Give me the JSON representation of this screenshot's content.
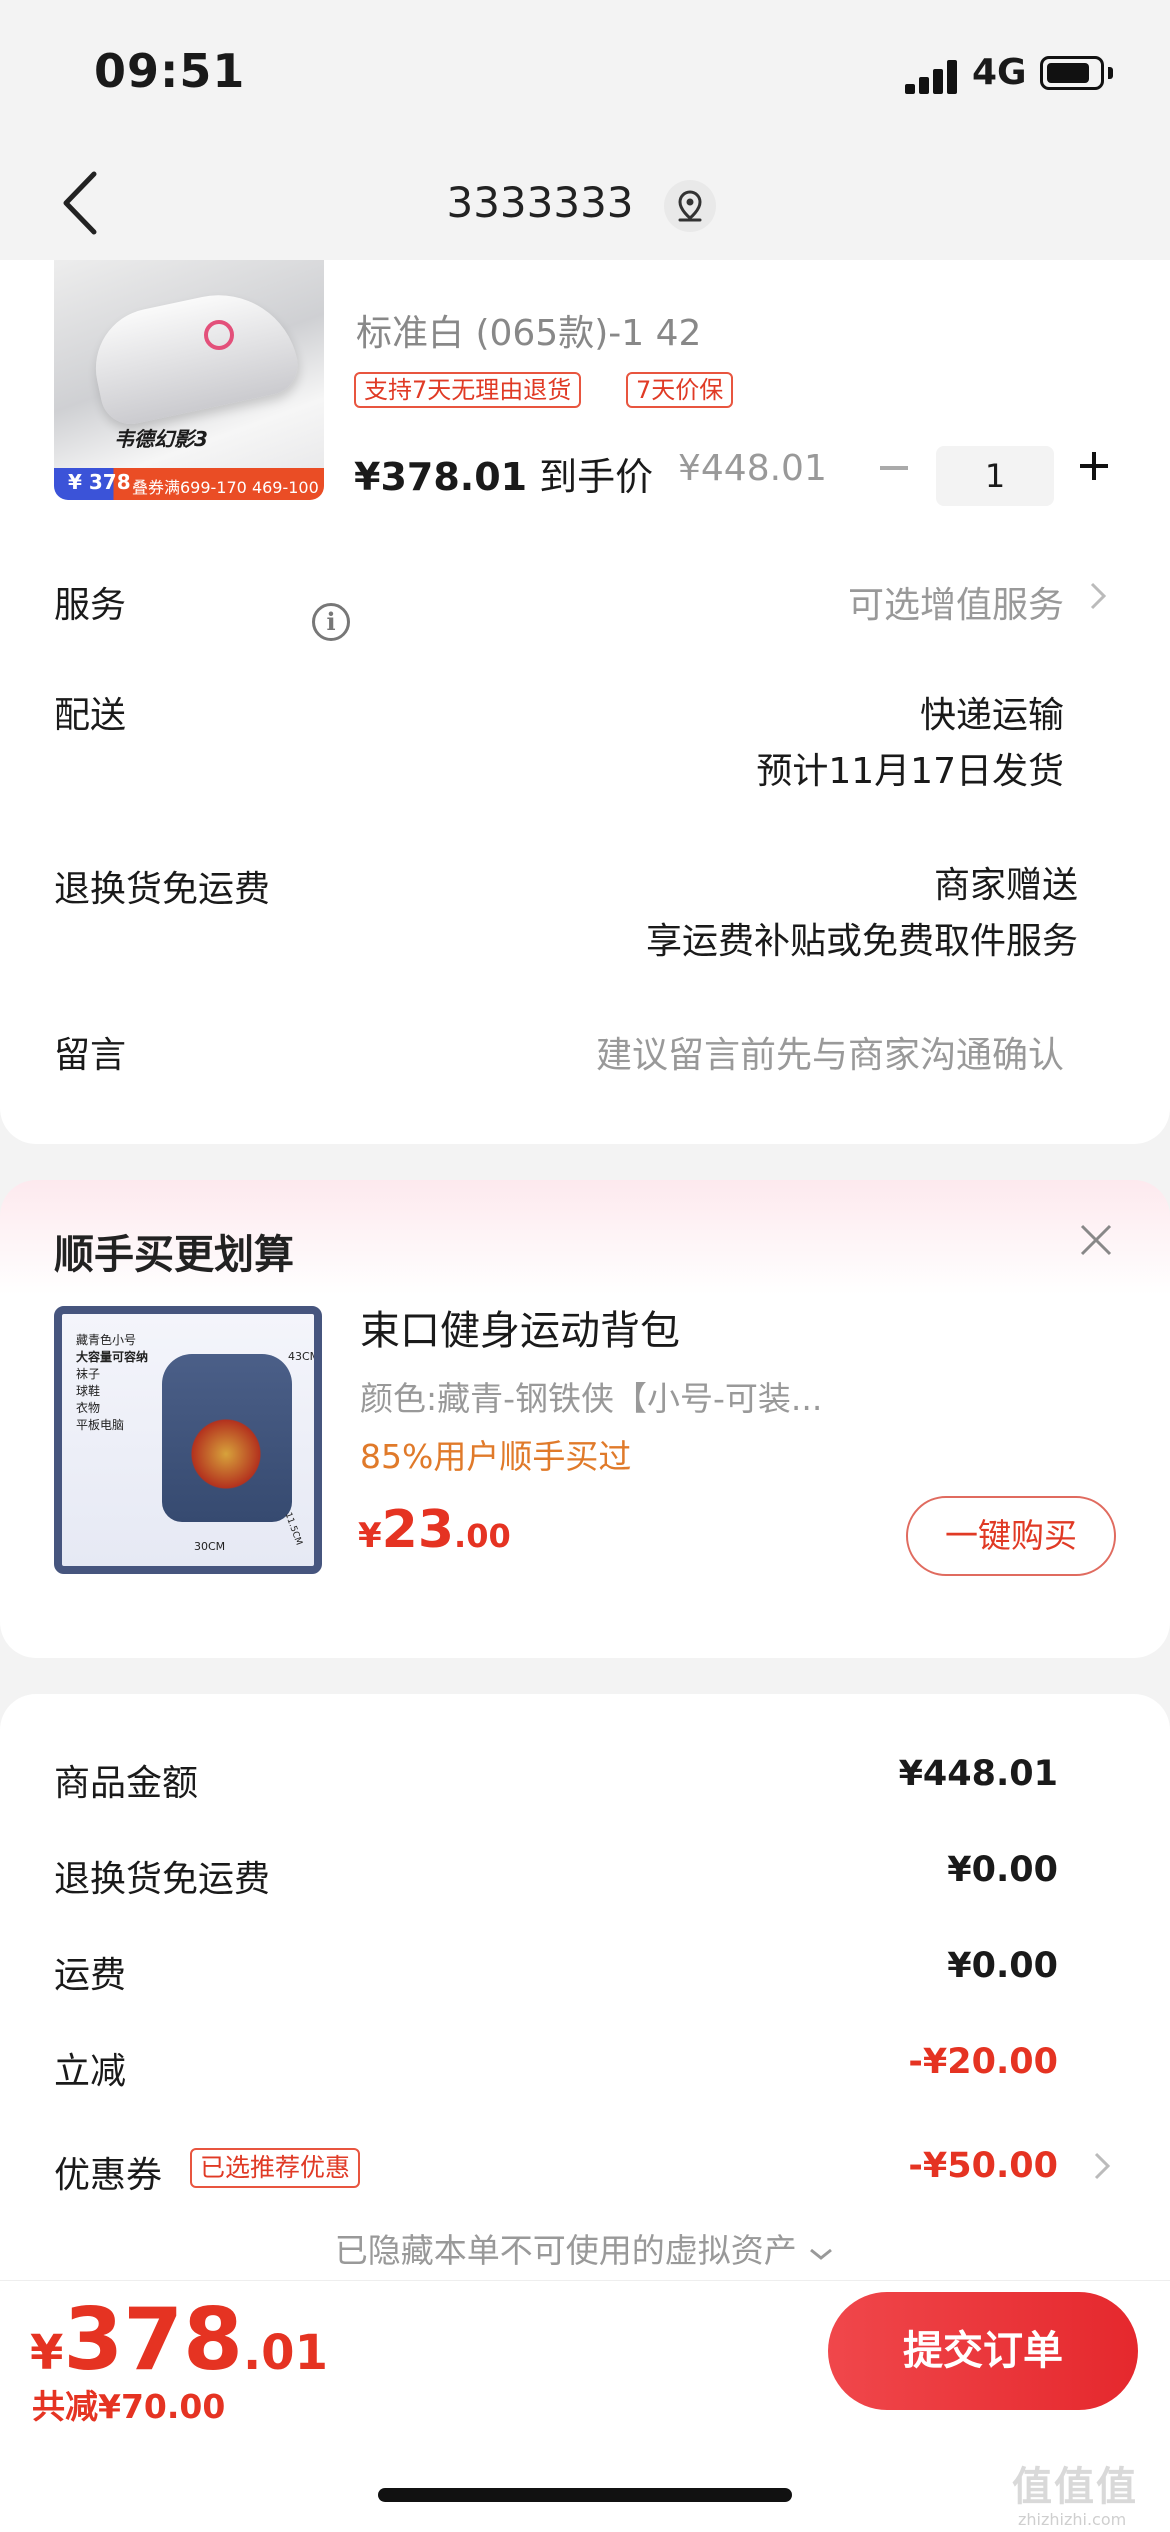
{
  "status_bar": {
    "time": "09:51",
    "network": "4G"
  },
  "header": {
    "title": "3333333"
  },
  "product": {
    "image_name": "韦德幻影3",
    "image_price": "¥ 378",
    "image_deal": "叠券满699-170  469-100",
    "sku": "标准白 (065款)-1 42",
    "tags": [
      "支持7天无理由退货",
      "7天价保"
    ],
    "price_now": "¥378.01",
    "price_now_suffix": "到手价",
    "price_orig": "¥448.01",
    "quantity": "1"
  },
  "rows": {
    "service_label": "服务",
    "service_value": "可选增值服务",
    "delivery_label": "配送",
    "delivery_value": "快递运输",
    "delivery_eta": "预计11月17日发货",
    "return_label": "退换货免运费",
    "return_value": "商家赠送",
    "return_desc": "享运费补贴或免费取件服务",
    "message_label": "留言",
    "message_placeholder": "建议留言前先与商家沟通确认"
  },
  "recommend": {
    "title": "顺手买更划算",
    "name": "束口健身运动背包",
    "spec": "颜色:藏青-钢铁侠【小号-可装...",
    "rate": "85%用户顺手买过",
    "price_currency": "¥",
    "price_int": "23",
    "price_dec": ".00",
    "buy_label": "一键购买",
    "image_labels": [
      "藏青色小号",
      "大容量可容纳",
      "袜子",
      "球鞋",
      "衣物",
      "平板电脑",
      "30CM",
      "43CM",
      "11.5CM"
    ]
  },
  "summary": {
    "items": [
      {
        "label": "商品金额",
        "value": "¥448.01",
        "color": "#1a1a1a"
      },
      {
        "label": "退换货免运费",
        "value": "¥0.00",
        "color": "#1a1a1a"
      },
      {
        "label": "运费",
        "value": "¥0.00",
        "color": "#1a1a1a"
      },
      {
        "label": "立减",
        "value": "-¥20.00",
        "color": "#e53322"
      },
      {
        "label": "优惠券",
        "value": "-¥50.00",
        "color": "#e53322"
      }
    ],
    "coupon_tag": "已选推荐优惠",
    "hidden_note": "已隐藏本单不可使用的虚拟资产"
  },
  "footer": {
    "total_currency": "¥",
    "total_int": "378",
    "total_dec": ".01",
    "saved": "共减¥70.00",
    "submit_label": "提交订单"
  },
  "watermark": {
    "text": "值值值",
    "url": "zhizhizhi.com"
  },
  "colors": {
    "accent": "#e53322",
    "submit": "#e5282d"
  },
  "icons": [
    "back-icon",
    "location-icon",
    "info-icon",
    "close-icon",
    "chevron-right-icon",
    "chevron-down-icon",
    "minus-icon",
    "plus-icon"
  ]
}
